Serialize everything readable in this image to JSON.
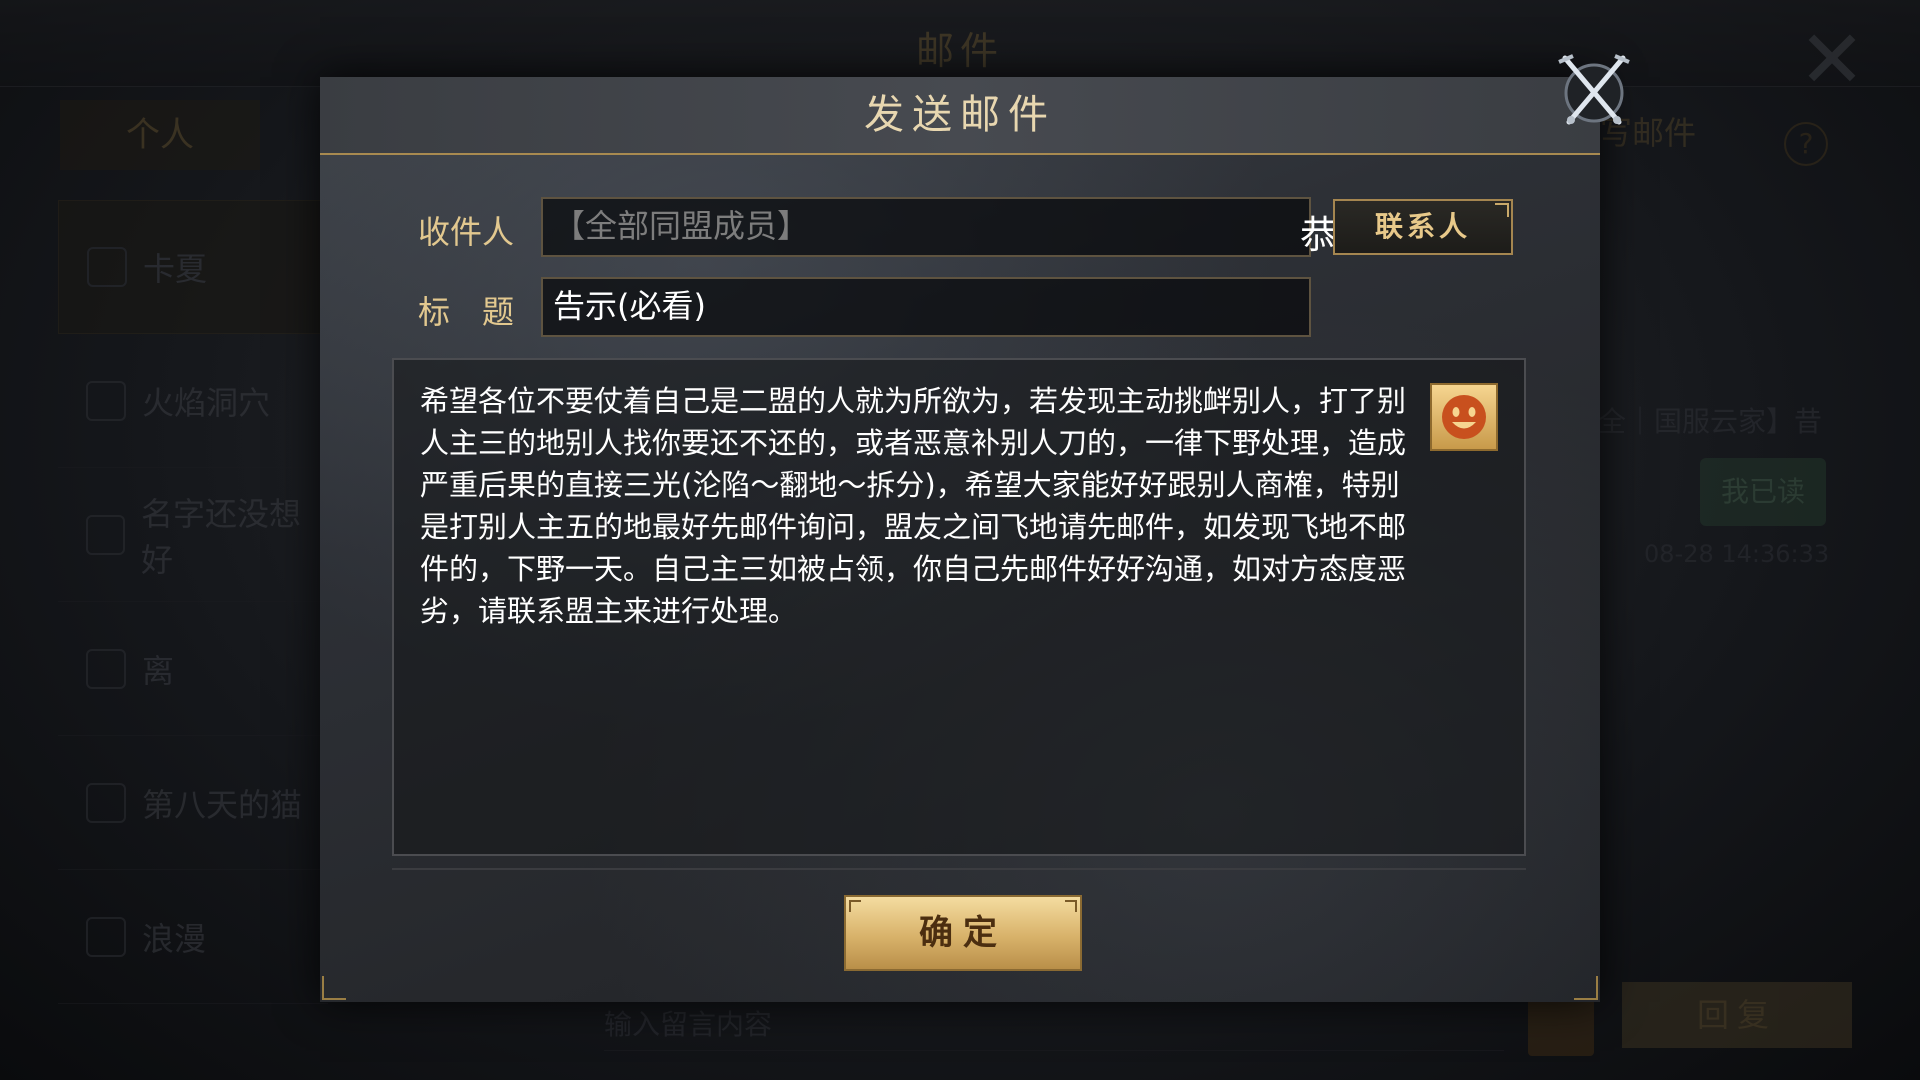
{
  "background": {
    "title": "邮件",
    "tab_left": "个人",
    "tab_right": "写邮件",
    "help": "?",
    "list_items": [
      "卡夏",
      "火焰洞穴",
      "名字还没想好",
      "离",
      "第八天的猫",
      "浪漫"
    ],
    "message_preview": "【全｜国服云家】昔",
    "bubble": "我已读",
    "time": "08-28 14:36:33",
    "input_placeholder": "输入留言内容",
    "reply_button": "回复"
  },
  "modal": {
    "title": "发送邮件",
    "recipient_label": "收件人",
    "recipient_value": "【全部同盟成员】",
    "recipient_overflow": "恭喜",
    "contact_button": "联系人",
    "subject_label": "标　题",
    "subject_value": "告示(必看)",
    "body_text": "希望各位不要仗着自己是二盟的人就为所欲为，若发现主动挑衅别人，打了别人主三的地别人找你要还不还的，或者恶意补别人刀的，一律下野处理，造成严重后果的直接三光(沦陷～翻地～拆分)，希望大家能好好跟别人商榷，特别是打别人主五的地最好先邮件询问，盟友之间飞地请先邮件，如发现飞地不邮件的，下野一天。自己主三如被占领，你自己先邮件好好沟通，如对方态度恶劣，请联系盟主来进行处理。",
    "confirm_button": "确定"
  },
  "icons": {
    "close": "crossed-swords-close-icon",
    "emoji": "smiley-face-icon"
  },
  "colors": {
    "gold_text": "#e2c88f",
    "title_text": "#e8d7b0",
    "confirm_bg": "#d8b26a",
    "emoji_face": "#c8501e"
  }
}
